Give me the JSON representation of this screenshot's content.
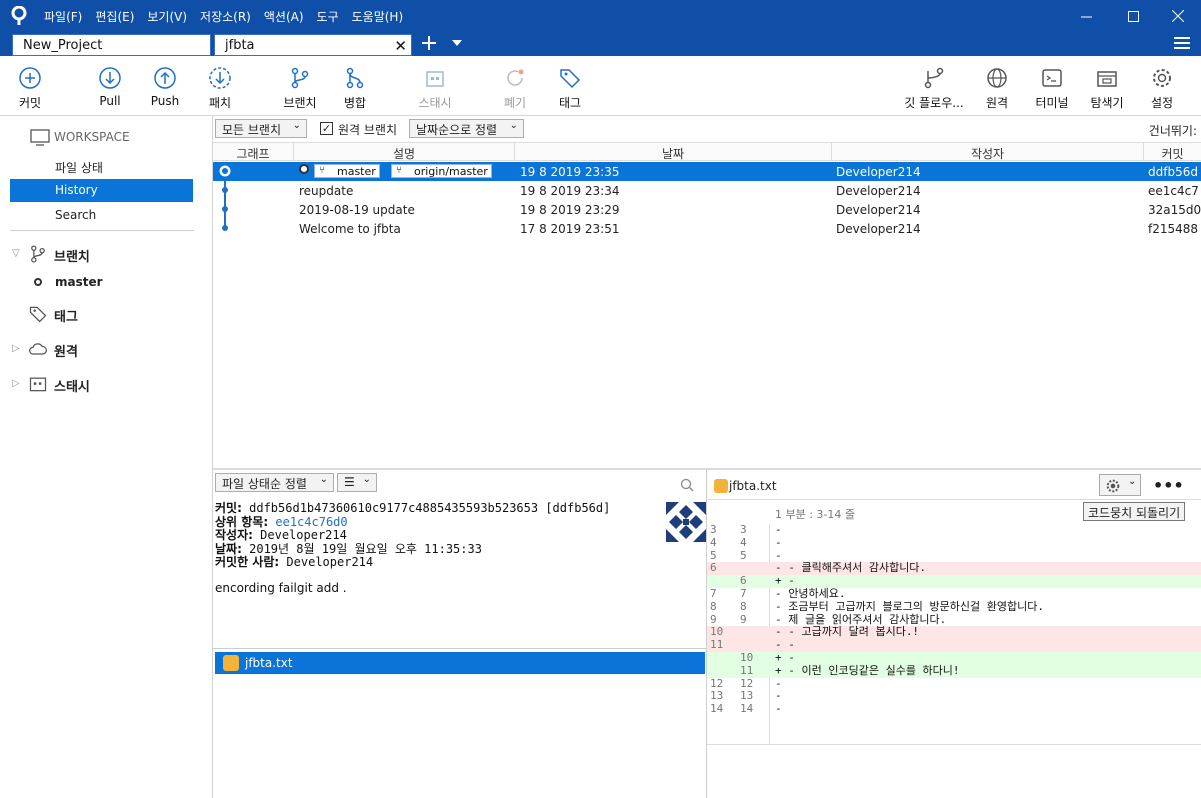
{
  "menu": [
    "파일(F)",
    "편집(E)",
    "보기(V)",
    "저장소(R)",
    "액션(A)",
    "도구",
    "도움말(H)"
  ],
  "tabs": [
    {
      "label": "New_Project"
    },
    {
      "label": "jfbta",
      "close": "✕"
    }
  ],
  "toolbar": {
    "commit": "커밋",
    "pull": "Pull",
    "push": "Push",
    "fetch": "패치",
    "branch": "브랜치",
    "merge": "병합",
    "stash": "스태시",
    "discard": "폐기",
    "tag": "태그",
    "gitflow": "깃 플로우...",
    "remote": "원격",
    "terminal": "터미널",
    "explorer": "탐색기",
    "settings": "설정"
  },
  "sidebar": {
    "workspace": "WORKSPACE",
    "items": [
      "파일 상태",
      "History",
      "Search"
    ],
    "branches": "브랜치",
    "current_branch": "master",
    "tags": "태그",
    "remotes": "원격",
    "stashes": "스태시"
  },
  "filters": {
    "branches": "모든 브랜치",
    "remote_branches": "원격 브랜치",
    "sort": "날짜순으로 정렬",
    "jump": "건너뛰기:"
  },
  "table": {
    "headers": [
      "그래프",
      "설명",
      "날짜",
      "작성자",
      "커밋"
    ],
    "rows": [
      {
        "desc": "",
        "refs": [
          "master",
          "origin/master"
        ],
        "date": "19 8 2019 23:35",
        "author": "Developer214",
        "hash": "ddfb56d"
      },
      {
        "desc": "reupdate",
        "date": "19 8 2019 23:34",
        "author": "Developer214",
        "hash": "ee1c4c7"
      },
      {
        "desc": "2019-08-19 update",
        "date": "19 8 2019 23:29",
        "author": "Developer214",
        "hash": "32a15d0"
      },
      {
        "desc": "Welcome to jfbta",
        "date": "17 8 2019 23:51",
        "author": "Developer214",
        "hash": "f215488"
      }
    ]
  },
  "files": {
    "sort": "파일 상태순 정렬",
    "list": [
      "jfbta.txt"
    ]
  },
  "commit_detail": {
    "commit_label": "커밋:",
    "commit_value": "ddfb56d1b47360610c9177c4885435593b523653 [ddfb56d]",
    "parent_label": "상위 항목:",
    "parent_value": "ee1c4c76d0",
    "author_label": "작성자:",
    "author_value": "Developer214",
    "date_label": "날짜:",
    "date_value": "2019년 8월 19일 월요일 오후 11:35:33",
    "committer_label": "커밋한 사람:",
    "committer_value": "Developer214",
    "message": "encording failgit add ."
  },
  "diff": {
    "file": "jfbta.txt",
    "hunk": "1 부분 : 3-14 줄",
    "revert": "코드뭉치 되돌리기",
    "more": "•••",
    "lines": [
      {
        "t": "ctx",
        "o": "3",
        "n": "3",
        "text": "-"
      },
      {
        "t": "ctx",
        "o": "4",
        "n": "4",
        "text": "-"
      },
      {
        "t": "ctx",
        "o": "5",
        "n": "5",
        "text": "-"
      },
      {
        "t": "del",
        "o": "6",
        "n": "",
        "text": "- - 클릭해주셔서 감사합니다."
      },
      {
        "t": "add",
        "o": "",
        "n": "6",
        "text": "+ -"
      },
      {
        "t": "ctx",
        "o": "7",
        "n": "7",
        "text": "- 안녕하세요."
      },
      {
        "t": "ctx",
        "o": "8",
        "n": "8",
        "text": "- 조금부터 고급까지 블로그의 방문하신걸 환영합니다."
      },
      {
        "t": "ctx",
        "o": "9",
        "n": "9",
        "text": "- 제 글을 읽어주셔서 감사합니다."
      },
      {
        "t": "del",
        "o": "10",
        "n": "",
        "text": "- - 고급까지 달려 봅시다.!"
      },
      {
        "t": "del",
        "o": "11",
        "n": "",
        "text": "- -"
      },
      {
        "t": "add",
        "o": "",
        "n": "10",
        "text": "+ -"
      },
      {
        "t": "add",
        "o": "",
        "n": "11",
        "text": "+ - 이런 인코딩같은 실수를 하다니!"
      },
      {
        "t": "ctx",
        "o": "12",
        "n": "12",
        "text": "-"
      },
      {
        "t": "ctx",
        "o": "13",
        "n": "13",
        "text": "-"
      },
      {
        "t": "ctx",
        "o": "14",
        "n": "14",
        "text": "-"
      }
    ]
  },
  "colors": {
    "titlebar": "#0f4fa8",
    "selection": "#0a74d9",
    "accent": "#1f6fc7"
  }
}
